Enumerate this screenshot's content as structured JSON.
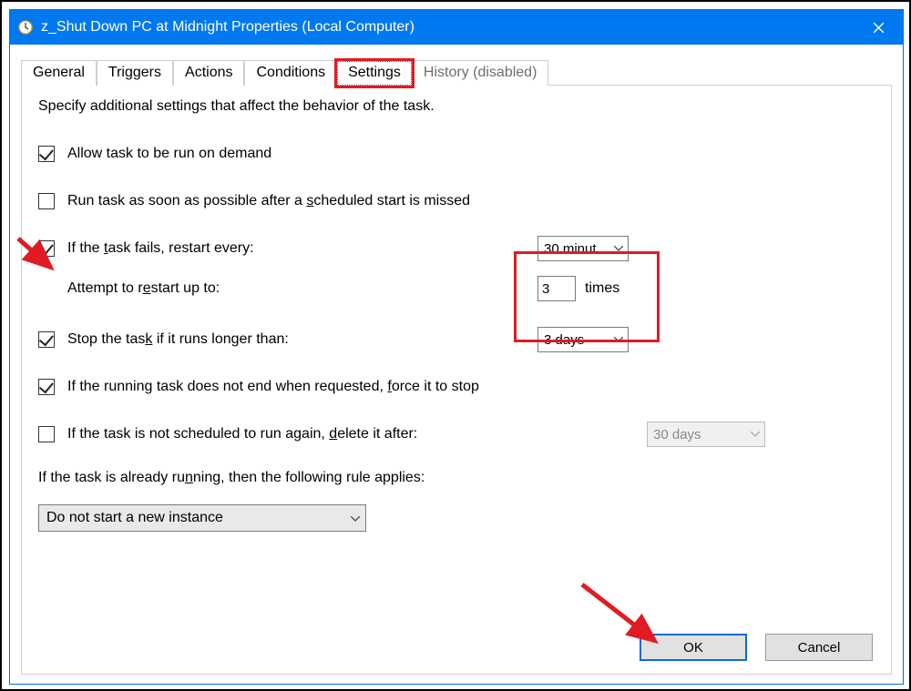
{
  "window": {
    "title": "z_Shut Down PC at Midnight Properties (Local Computer)"
  },
  "tabs": {
    "general": "General",
    "triggers": "Triggers",
    "actions": "Actions",
    "conditions": "Conditions",
    "settings": "Settings",
    "history": "History (disabled)"
  },
  "intro": "Specify additional settings that affect the behavior of the task.",
  "settings": {
    "allow_on_demand": {
      "label": "Allow task to be run on demand",
      "checked": true
    },
    "run_asap": {
      "label_pre": "Run task as soon as possible after a ",
      "label_ul": "s",
      "label_post": "cheduled start is missed",
      "checked": false
    },
    "restart_if_fail": {
      "label_pre": "If the ",
      "label_ul": "t",
      "label_post": "ask fails, restart every:",
      "checked": true,
      "interval": "30 minut"
    },
    "attempt_up_to": {
      "label_pre": "Attempt to r",
      "label_ul": "e",
      "label_post": "start up to:",
      "count": "3",
      "unit": "times"
    },
    "stop_if_longer": {
      "label_pre": "Stop the tas",
      "label_ul": "k",
      "label_post": " if it runs longer than:",
      "checked": true,
      "duration": "3 days"
    },
    "force_stop": {
      "label_pre": "If the running task does not end when requested, ",
      "label_ul": "f",
      "label_post": "orce it to stop",
      "checked": true
    },
    "delete_after": {
      "label_pre": "If the task is not scheduled to run again, ",
      "label_ul": "d",
      "label_post": "elete it after:",
      "checked": false,
      "duration": "30 days"
    },
    "already_running_rule": {
      "label_pre": "If the task is already ru",
      "label_ul": "n",
      "label_post": "ning, then the following rule applies:",
      "selected": "Do not start a new instance"
    }
  },
  "buttons": {
    "ok": "OK",
    "cancel": "Cancel"
  }
}
